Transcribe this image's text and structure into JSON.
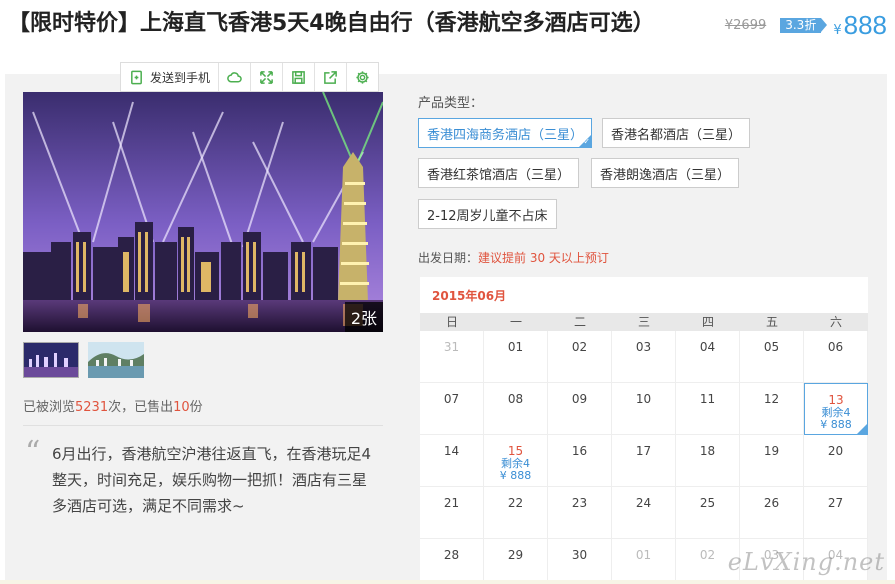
{
  "product": {
    "title": "【限时特价】上海直飞香港5天4晚自由行（香港航空多酒店可选）",
    "old_price": "¥2699",
    "discount": "3.3折",
    "currency": "¥",
    "price": "888"
  },
  "toolbar": {
    "send_to_phone": "发送到手机",
    "icons": [
      "cloud-icon",
      "expand-icon",
      "save-icon",
      "share-icon",
      "gear-icon"
    ]
  },
  "gallery": {
    "count": "2张"
  },
  "stats": {
    "viewed_prefix": "已被浏览",
    "views": "5231",
    "viewed_mid": "次，已售出",
    "sold": "10",
    "sold_suffix": "份"
  },
  "description": {
    "quote_mark": "“",
    "text": "6月出行，香港航空沪港往返直飞，在香港玩足4整天，时间充足，娱乐购物一把抓！酒店有三星多酒店可选，满足不同需求~"
  },
  "product_types": {
    "label": "产品类型：",
    "options": [
      {
        "label": "香港四海商务酒店（三星）",
        "selected": true
      },
      {
        "label": "香港名都酒店（三星）",
        "selected": false
      },
      {
        "label": "香港红茶馆酒店（三星）",
        "selected": false
      },
      {
        "label": "香港朗逸酒店（三星）",
        "selected": false
      },
      {
        "label": "2-12周岁儿童不占床",
        "selected": false
      }
    ],
    "tick": "✓"
  },
  "departure": {
    "label": "出发日期：",
    "note": "建议提前 30 天以上预订"
  },
  "calendar": {
    "month": "2015年06月",
    "weekdays": [
      "日",
      "一",
      "二",
      "三",
      "四",
      "五",
      "六"
    ],
    "days": [
      {
        "d": "31",
        "muted": true
      },
      {
        "d": "01"
      },
      {
        "d": "02"
      },
      {
        "d": "03"
      },
      {
        "d": "04"
      },
      {
        "d": "05"
      },
      {
        "d": "06"
      },
      {
        "d": "07"
      },
      {
        "d": "08"
      },
      {
        "d": "09"
      },
      {
        "d": "10"
      },
      {
        "d": "11"
      },
      {
        "d": "12"
      },
      {
        "d": "13",
        "avail": true,
        "remain": "剩余4",
        "price": "¥ 888",
        "selected": true
      },
      {
        "d": "14"
      },
      {
        "d": "15",
        "avail": true,
        "remain": "剩余4",
        "price": "¥ 888"
      },
      {
        "d": "16"
      },
      {
        "d": "17"
      },
      {
        "d": "18"
      },
      {
        "d": "19"
      },
      {
        "d": "20"
      },
      {
        "d": "21"
      },
      {
        "d": "22"
      },
      {
        "d": "23"
      },
      {
        "d": "24"
      },
      {
        "d": "25"
      },
      {
        "d": "26"
      },
      {
        "d": "27"
      },
      {
        "d": "28"
      },
      {
        "d": "29"
      },
      {
        "d": "30"
      },
      {
        "d": "01",
        "muted": true
      },
      {
        "d": "02",
        "muted": true
      },
      {
        "d": "03",
        "muted": true
      },
      {
        "d": "04",
        "muted": true
      }
    ]
  },
  "watermark": "eLvXing.net"
}
